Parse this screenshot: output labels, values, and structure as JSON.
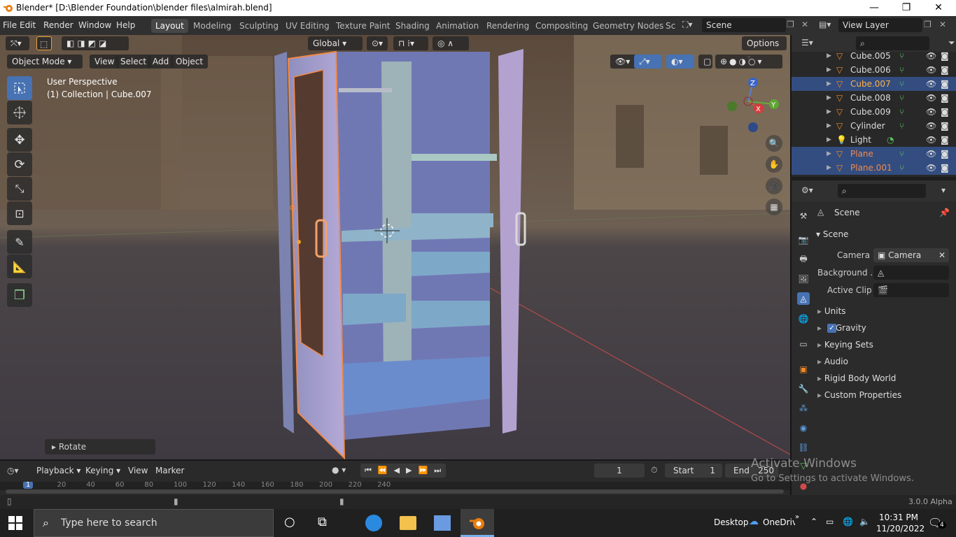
{
  "window": {
    "title": "Blender* [D:\\Blender Foundation\\blender files\\almirah.blend]",
    "minimize": "—",
    "maximize": "❐",
    "close": "✕"
  },
  "menu": {
    "items": [
      "File",
      "Edit",
      "Render",
      "Window",
      "Help"
    ]
  },
  "workspaces": {
    "tabs": [
      "Layout",
      "Modeling",
      "Sculpting",
      "UV Editing",
      "Texture Paint",
      "Shading",
      "Animation",
      "Rendering",
      "Compositing",
      "Geometry Nodes",
      "Sc"
    ],
    "active": "Layout"
  },
  "scene": {
    "name": "Scene",
    "view_layer": "View Layer"
  },
  "toolbar": {
    "transform_orientation": "Global",
    "options": "Options"
  },
  "viewport": {
    "mode": "Object Mode",
    "menus": [
      "View",
      "Select",
      "Add",
      "Object"
    ],
    "perspective": "User Perspective",
    "collection": "(1) Collection | Cube.007",
    "last_op": "Rotate"
  },
  "gizmo": {
    "x": "X",
    "y": "Y",
    "z": "Z"
  },
  "outliner": {
    "rows": [
      {
        "name": "Cube.005",
        "type": "mesh",
        "selected": false,
        "active": false
      },
      {
        "name": "Cube.006",
        "type": "mesh",
        "selected": false,
        "active": false
      },
      {
        "name": "Cube.007",
        "type": "mesh",
        "selected": true,
        "active": true
      },
      {
        "name": "Cube.008",
        "type": "mesh",
        "selected": false,
        "active": false
      },
      {
        "name": "Cube.009",
        "type": "mesh",
        "selected": false,
        "active": false
      },
      {
        "name": "Cylinder",
        "type": "mesh",
        "selected": false,
        "active": false
      },
      {
        "name": "Light",
        "type": "light",
        "selected": false,
        "active": false
      },
      {
        "name": "Plane",
        "type": "mesh",
        "selected": true,
        "active": false
      },
      {
        "name": "Plane.001",
        "type": "mesh",
        "selected": true,
        "active": false
      }
    ]
  },
  "properties": {
    "header": "Scene",
    "panel": "Scene",
    "camera_label": "Camera",
    "camera_value": "Camera",
    "background_label": "Background ...",
    "active_clip_label": "Active Clip",
    "sections": [
      "Units",
      "Gravity",
      "Keying Sets",
      "Audio",
      "Rigid Body World",
      "Custom Properties"
    ],
    "gravity_checked": true
  },
  "timeline": {
    "menus": [
      "Playback",
      "Keying",
      "View",
      "Marker"
    ],
    "current_frame": "1",
    "start_label": "Start",
    "start": "1",
    "end_label": "End",
    "end": "250",
    "ticks": [
      "1",
      "20",
      "40",
      "60",
      "80",
      "100",
      "120",
      "140",
      "160",
      "180",
      "200",
      "220",
      "240"
    ]
  },
  "status": {
    "version": "3.0.0 Alpha"
  },
  "watermark": {
    "line1": "Activate Windows",
    "line2": "Go to Settings to activate Windows."
  },
  "taskbar": {
    "search_placeholder": "Type here to search",
    "desktop": "Desktop",
    "onedrive": "OneDrive",
    "time": "10:31 PM",
    "date": "11/20/2022",
    "notifications": "4"
  },
  "colors": {
    "accent": "#4772b3",
    "selected_row": "#334d80",
    "selection_outline": "#f08a4b",
    "active_text": "#ffb24a"
  }
}
